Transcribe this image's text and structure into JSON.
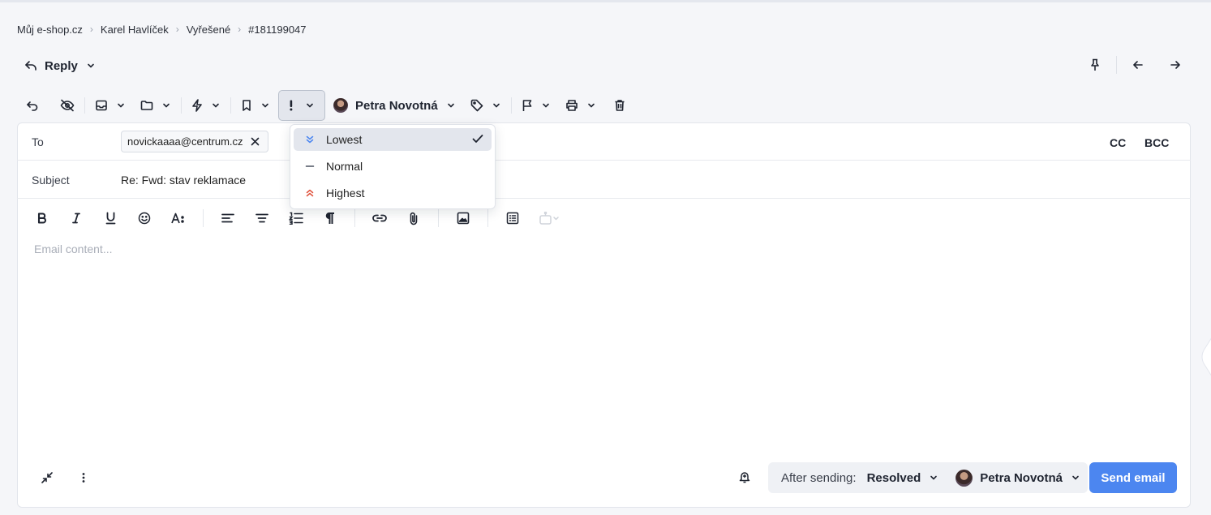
{
  "breadcrumb": [
    "Můj e-shop.cz",
    "Karel Havlíček",
    "Vyřešené",
    "#181199047"
  ],
  "reply": {
    "label": "Reply"
  },
  "toolbar": {
    "assignee": "Petra Novotná"
  },
  "priority_menu": {
    "items": [
      {
        "label": "Lowest",
        "selected": true,
        "icon": "chevrons-down-icon",
        "color": "#4c86f0"
      },
      {
        "label": "Normal",
        "selected": false,
        "icon": "dash-icon",
        "color": "#6b7280"
      },
      {
        "label": "Highest",
        "selected": false,
        "icon": "chevrons-up-icon",
        "color": "#e0543e"
      }
    ]
  },
  "compose": {
    "to_label": "To",
    "to_recipient": "novickaaaa@centrum.cz",
    "cc_label": "CC",
    "bcc_label": "BCC",
    "subject_label": "Subject",
    "subject_value": "Re: Fwd: stav reklamace",
    "body_placeholder": "Email content..."
  },
  "footer": {
    "after_sending_label": "After sending:",
    "after_sending_value": "Resolved",
    "assignee": "Petra Novotná",
    "send_label": "Send email"
  },
  "colors": {
    "accent": "#4c86f0",
    "highest": "#e0543e"
  }
}
